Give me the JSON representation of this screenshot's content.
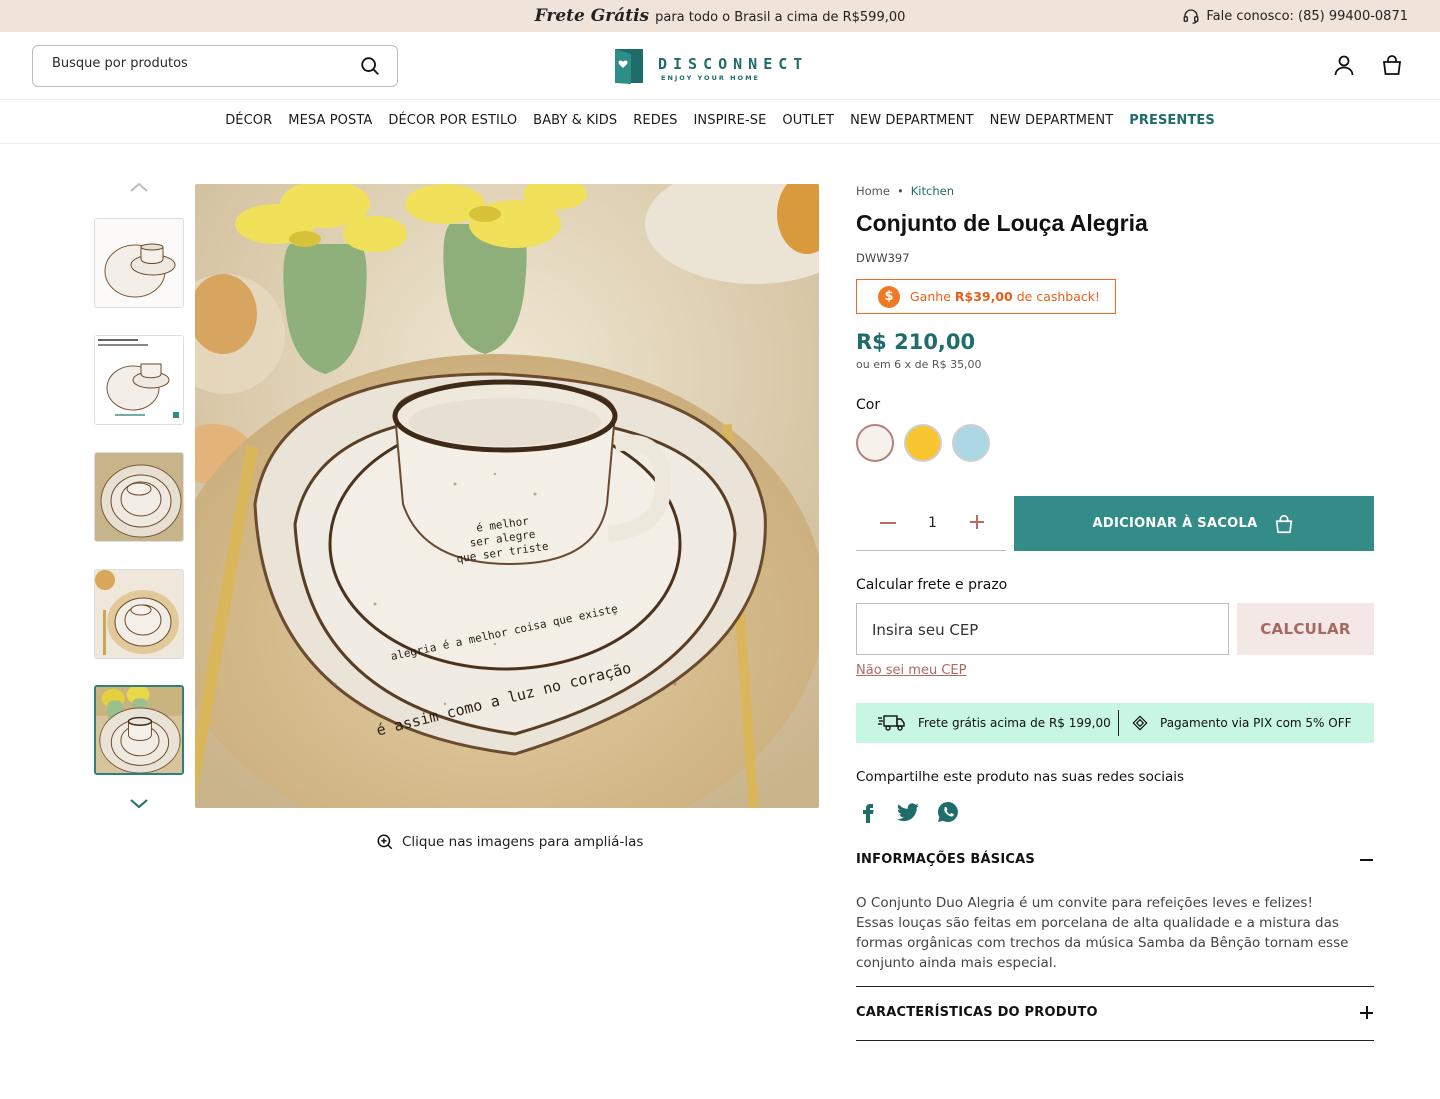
{
  "topbar": {
    "promo_script": "Frete Grátis",
    "promo_text": "para todo o Brasil a cima de R$599,00",
    "contact": "Fale conosco: (85) 99400-0871"
  },
  "header": {
    "search_placeholder": "Busque por produtos",
    "logo_word": "DISCONNECT",
    "logo_tag": "ENJOY YOUR HOME"
  },
  "nav": {
    "items": [
      "DÉCOR",
      "MESA POSTA",
      "DÉCOR POR ESTILO",
      "BABY & KIDS",
      "REDES",
      "INSPIRE-SE",
      "OUTLET",
      "NEW DEPARTMENT",
      "NEW DEPARTMENT",
      "PRESENTES"
    ]
  },
  "gallery": {
    "zoom_hint": "Clique nas imagens para ampliá-las",
    "cup_text_1": "é melhor",
    "cup_text_2": "ser alegre",
    "cup_text_3": "que ser triste",
    "saucer_text": "alegria é a melhor coisa que existe",
    "plate_text": "é assim como a luz no coração"
  },
  "product": {
    "breadcrumb": [
      "Home",
      "Kitchen"
    ],
    "title": "Conjunto de Louça Alegria",
    "sku": "DWW397",
    "cashback_prefix": "Ganhe",
    "cashback_value": "R$39,00",
    "cashback_suffix": "de cashback!",
    "price": "R$ 210,00",
    "installments": "ou em 6 x de R$ 35,00",
    "color_label": "Cor",
    "colors": [
      "#f7f1ec",
      "#f7c631",
      "#acd8e6"
    ],
    "quantity": "1",
    "add_button": "ADICIONAR À SACOLA",
    "shipping_label": "Calcular frete e prazo",
    "cep_placeholder": "Insira seu CEP",
    "calc_button": "CALCULAR",
    "no_cep": "Não sei meu CEP",
    "banner_free": "Frete grátis acima de R$ 199,00",
    "banner_pix": "Pagamento via PIX com 5% OFF",
    "share_label": "Compartilhe este produto nas suas redes sociais",
    "acc1_title": "INFORMAÇÕES BÁSICAS",
    "acc1_body_1": "O Conjunto Duo Alegria é um convite para refeições leves e felizes!",
    "acc1_body_2": "Essas louças são feitas em porcelana de alta qualidade e a mistura das formas orgânicas com trechos da música Samba da Bênção tornam esse conjunto ainda mais especial.",
    "acc2_title": "CARACTERÍSTICAS DO PRODUTO"
  },
  "colors": {
    "brand": "#1f6d6a",
    "button": "#348c88",
    "accent": "#b0685f",
    "cashback": "#ef6a1c",
    "banner": "#c7f6e2"
  }
}
